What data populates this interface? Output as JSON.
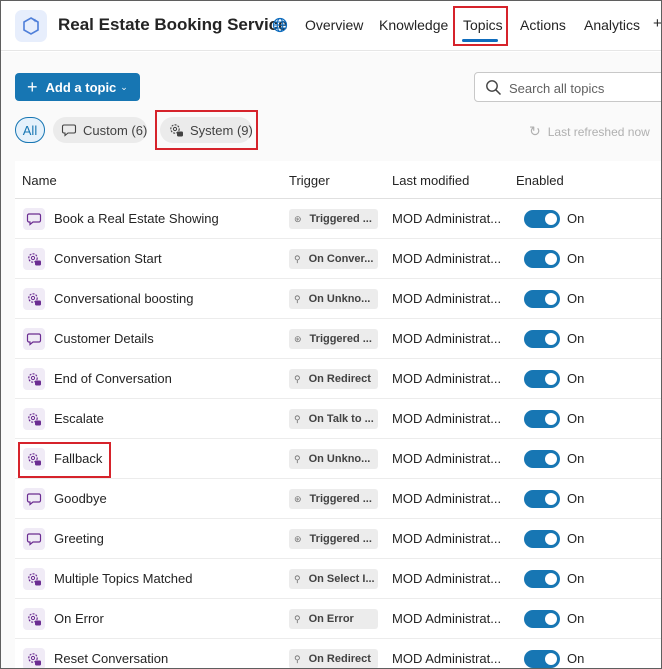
{
  "header": {
    "agent_icon": "agent-hexagon-icon",
    "title": "Real Estate Booking Service",
    "globe_icon": "globe-icon",
    "tabs": [
      {
        "label": "Overview"
      },
      {
        "label": "Knowledge"
      },
      {
        "label": "Topics"
      },
      {
        "label": "Actions"
      },
      {
        "label": "Analytics"
      }
    ],
    "active_tab": "Topics",
    "more_label": "+"
  },
  "toolbar": {
    "add_plus": "+",
    "add_label": "Add a topic",
    "add_chevron": "⌄",
    "search_placeholder": "Search all topics"
  },
  "filters": {
    "all": "All",
    "custom": "Custom (6)",
    "system": "System (9)",
    "refresh_label": "Last refreshed now"
  },
  "table": {
    "columns": {
      "name": "Name",
      "trigger": "Trigger",
      "modified": "Last modified",
      "enabled": "Enabled"
    },
    "rows": [
      {
        "name": "Book a Real Estate Showing",
        "kind": "custom",
        "trigger": "Triggered ...",
        "trigger_icon": "phrase-icon",
        "modified": "MOD Administrat...",
        "enabled": "On"
      },
      {
        "name": "Conversation Start",
        "kind": "system",
        "trigger": "On Conver...",
        "trigger_icon": "event-icon",
        "modified": "MOD Administrat...",
        "enabled": "On"
      },
      {
        "name": "Conversational boosting",
        "kind": "system",
        "trigger": "On Unkno...",
        "trigger_icon": "event-icon",
        "modified": "MOD Administrat...",
        "enabled": "On"
      },
      {
        "name": "Customer Details",
        "kind": "custom",
        "trigger": "Triggered ...",
        "trigger_icon": "phrase-icon",
        "modified": "MOD Administrat...",
        "enabled": "On"
      },
      {
        "name": "End of Conversation",
        "kind": "system",
        "trigger": "On Redirect",
        "trigger_icon": "event-icon",
        "modified": "MOD Administrat...",
        "enabled": "On"
      },
      {
        "name": "Escalate",
        "kind": "system",
        "trigger": "On Talk to ...",
        "trigger_icon": "event-icon",
        "modified": "MOD Administrat...",
        "enabled": "On"
      },
      {
        "name": "Fallback",
        "kind": "system",
        "trigger": "On Unkno...",
        "trigger_icon": "event-icon",
        "modified": "MOD Administrat...",
        "enabled": "On"
      },
      {
        "name": "Goodbye",
        "kind": "custom",
        "trigger": "Triggered ...",
        "trigger_icon": "phrase-icon",
        "modified": "MOD Administrat...",
        "enabled": "On"
      },
      {
        "name": "Greeting",
        "kind": "custom",
        "trigger": "Triggered ...",
        "trigger_icon": "phrase-icon",
        "modified": "MOD Administrat...",
        "enabled": "On"
      },
      {
        "name": "Multiple Topics Matched",
        "kind": "system",
        "trigger": "On Select I...",
        "trigger_icon": "event-icon",
        "modified": "MOD Administrat...",
        "enabled": "On"
      },
      {
        "name": "On Error",
        "kind": "system",
        "trigger": "On Error",
        "trigger_icon": "event-icon",
        "modified": "MOD Administrat...",
        "enabled": "On"
      },
      {
        "name": "Reset Conversation",
        "kind": "system",
        "trigger": "On Redirect",
        "trigger_icon": "event-icon",
        "modified": "MOD Administrat...",
        "enabled": "On"
      }
    ]
  },
  "colors": {
    "accent": "#1776b3",
    "highlight": "#d6232b",
    "topic_icon": "#6b2c91"
  }
}
